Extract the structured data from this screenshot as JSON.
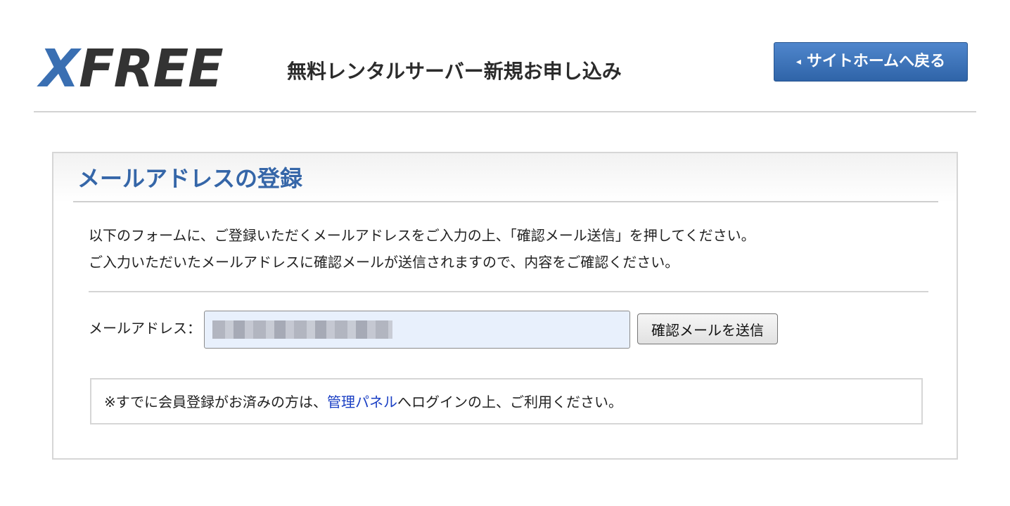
{
  "header": {
    "logo": {
      "x": "X",
      "rest": "FREE"
    },
    "title": "無料レンタルサーバー新規お申し込み",
    "back_button": {
      "chevron": "◂",
      "label": "サイトホームへ戻る"
    }
  },
  "panel": {
    "title": "メールアドレスの登録",
    "intro_line1": "以下のフォームに、ご登録いただくメールアドレスをご入力の上、「確認メール送信」を押してください。",
    "intro_line2": "ご入力いただいたメールアドレスに確認メールが送信されますので、内容をご確認ください。",
    "form": {
      "email_label": "メールアドレス：",
      "email_value": "",
      "submit_label": "確認メールを送信"
    },
    "note": {
      "prefix": "※すでに会員登録がお済みの方は、",
      "link": "管理パネル",
      "suffix": "へログインの上、ご利用ください。"
    }
  },
  "colors": {
    "accent": "#3566a8",
    "button_blue": "#2f64a8",
    "link": "#1a3fc4",
    "input_bg": "#e8f0fc"
  }
}
